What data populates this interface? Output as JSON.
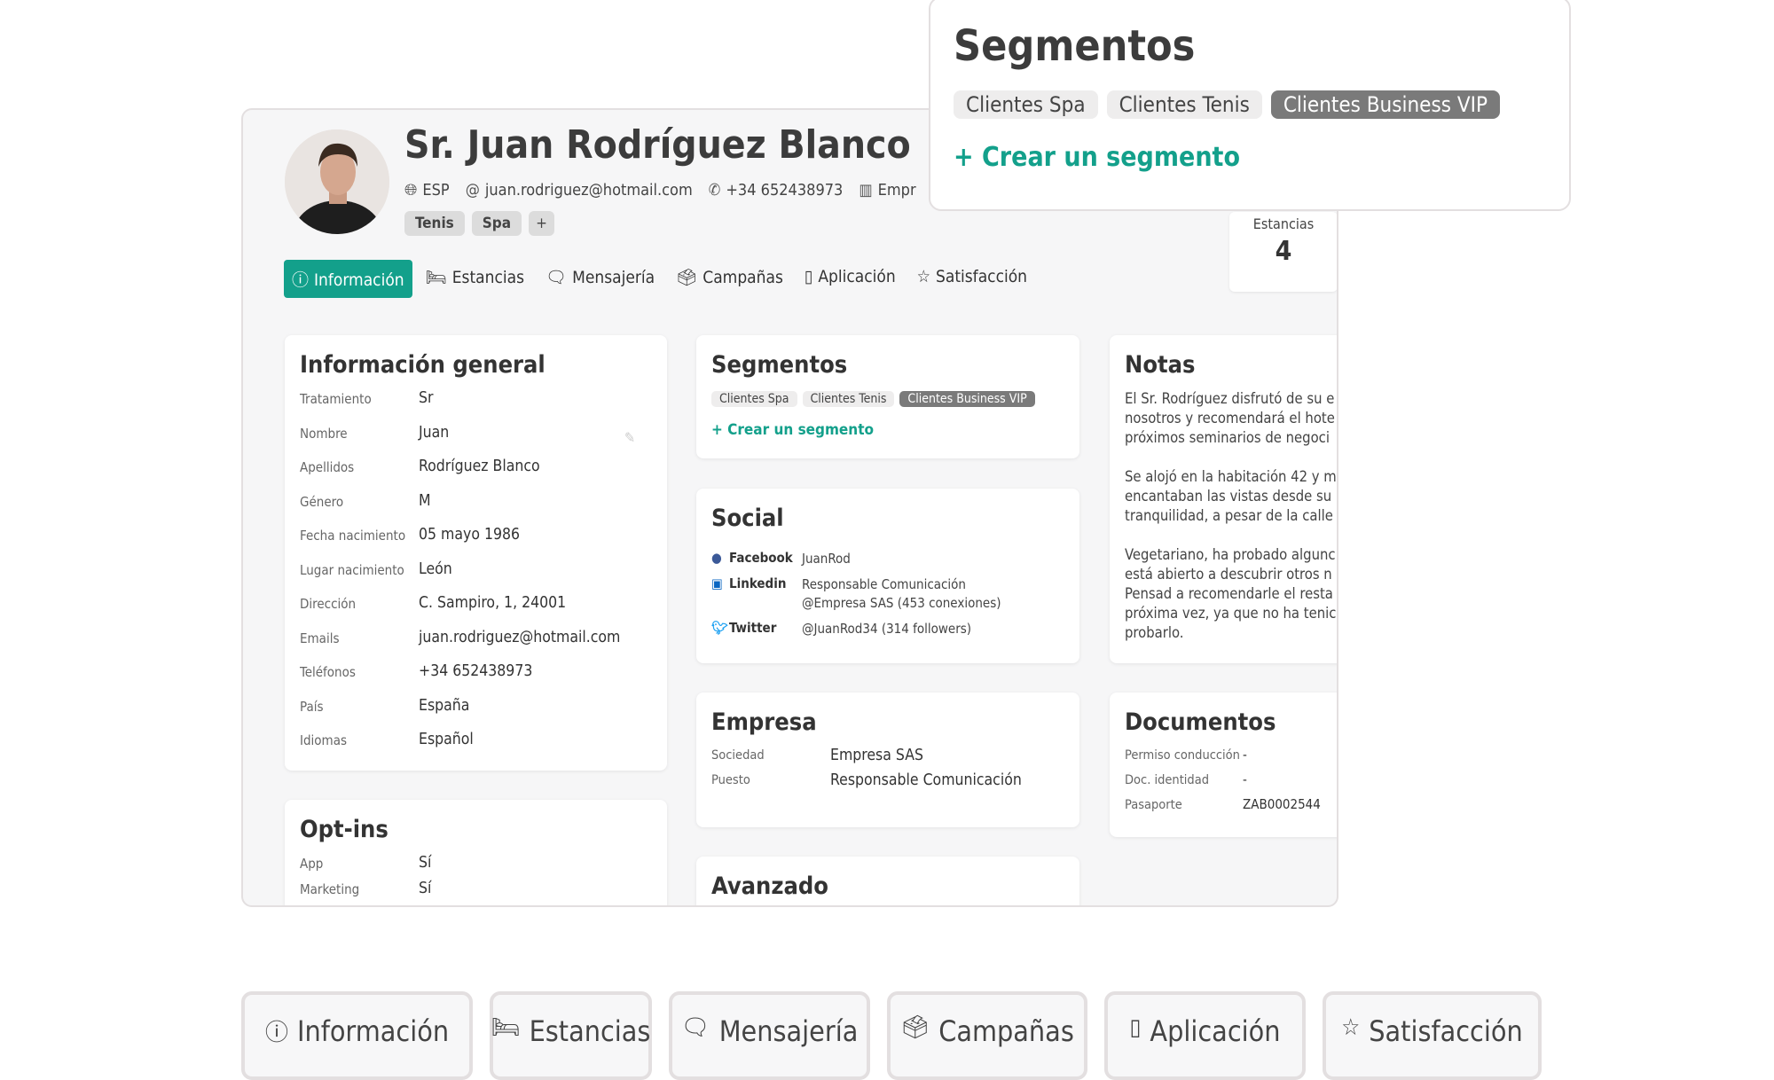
{
  "profile": {
    "name": "Sr. Juan Rodríguez Blanco",
    "country": "ESP",
    "email": "juan.rodriguez@hotmail.com",
    "phone": "+34 652438973",
    "company": "Empr",
    "tags": [
      "Tenis",
      "Spa",
      "+"
    ]
  },
  "tabs": [
    {
      "label": "Información",
      "icon": "info-icon"
    },
    {
      "label": "Estancias",
      "icon": "bed-icon"
    },
    {
      "label": "Mensajería",
      "icon": "chat-icon"
    },
    {
      "label": "Campañas",
      "icon": "inbox-icon"
    },
    {
      "label": "Aplicación",
      "icon": "phone-icon"
    },
    {
      "label": "Satisfacción",
      "icon": "star-icon"
    }
  ],
  "stays": {
    "label": "Estancias",
    "value": "4"
  },
  "general": {
    "title": "Información general",
    "rows": [
      {
        "k": "Tratamiento",
        "v": "Sr"
      },
      {
        "k": "Nombre",
        "v": "Juan"
      },
      {
        "k": "Apellidos",
        "v": "Rodríguez Blanco"
      },
      {
        "k": "Género",
        "v": "M"
      },
      {
        "k": "Fecha nacimiento",
        "v": "05 mayo 1986"
      },
      {
        "k": "Lugar nacimiento",
        "v": "León"
      },
      {
        "k": "Dirección",
        "v": "C. Sampiro, 1, 24001"
      },
      {
        "k": "Emails",
        "v": "juan.rodriguez@hotmail.com"
      },
      {
        "k": "Teléfonos",
        "v": "+34 652438973"
      },
      {
        "k": "País",
        "v": "España"
      },
      {
        "k": "Idiomas",
        "v": "Español"
      }
    ]
  },
  "optins": {
    "title": "Opt-ins",
    "rows": [
      {
        "k": "App",
        "v": "Sí"
      },
      {
        "k": "Marketing",
        "v": "Sí"
      }
    ]
  },
  "segments": {
    "title": "Segmentos",
    "items": [
      "Clientes Spa",
      "Clientes Tenis",
      "Clientes Business VIP"
    ],
    "create": "+ Crear un segmento"
  },
  "social": {
    "title": "Social",
    "items": [
      {
        "k": "Facebook",
        "v": "JuanRod"
      },
      {
        "k": "Linkedin",
        "v": "Responsable Comunicación",
        "v2": "@Empresa SAS (453 conexiones)"
      },
      {
        "k": "Twitter",
        "v": "@JuanRod34 (314 followers)"
      }
    ]
  },
  "company": {
    "title": "Empresa",
    "rows": [
      {
        "k": "Sociedad",
        "v": "Empresa SAS"
      },
      {
        "k": "Puesto",
        "v": "Responsable Comunicación"
      }
    ]
  },
  "advanced": {
    "title": "Avanzado"
  },
  "notes": {
    "title": "Notas",
    "lines": [
      "El Sr. Rodríguez disfrutó de su e",
      "nosotros y recomendará el hote",
      "próximos seminarios de negoci",
      "Se alojó en la habitación 42 y m",
      "encantaban las vistas desde su",
      "tranquilidad, a pesar de la calle",
      "Vegetariano, ha probado algunc",
      "está abierto a descubrir otros n",
      "Pensad a recomendarle el resta",
      "próxima vez, ya que no ha tenic",
      "probarlo."
    ]
  },
  "documents": {
    "title": "Documentos",
    "rows": [
      {
        "k": "Permiso conducción",
        "v": "-"
      },
      {
        "k": "Doc. identidad",
        "v": "-"
      },
      {
        "k": "Pasaporte",
        "v": "ZAB0002544"
      }
    ]
  },
  "colors": {
    "accent": "#13a08b",
    "tag": "#dcdcdc",
    "vip": "#7a7a7a"
  }
}
